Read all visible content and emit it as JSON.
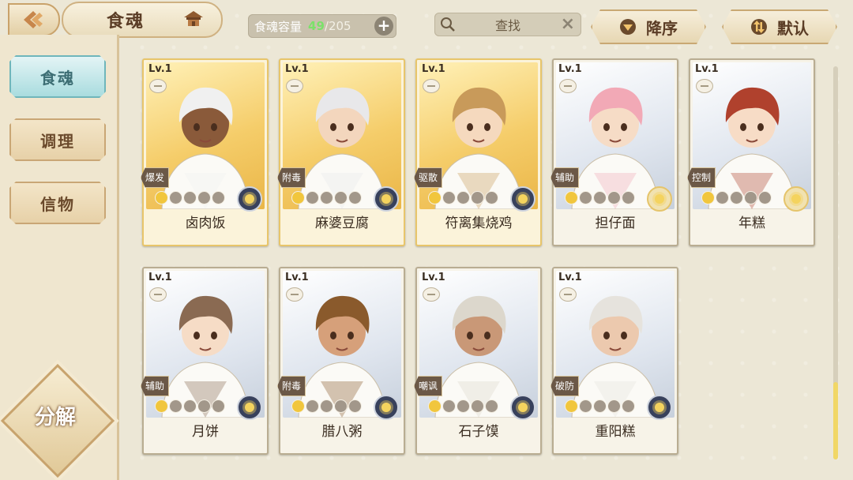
{
  "header": {
    "title": "食魂",
    "capacity_label": "食魂容量",
    "capacity_used": "49",
    "capacity_total": "/205",
    "search_label": "查找",
    "sort_desc_label": "降序",
    "sort_default_label": "默认"
  },
  "sidebar": {
    "tabs": [
      {
        "label": "食魂",
        "active": true
      },
      {
        "label": "调理",
        "active": false
      },
      {
        "label": "信物",
        "active": false
      }
    ],
    "decompose_label": "分解"
  },
  "cards": [
    {
      "level": "Lv.1",
      "name": "卤肉饭",
      "role": "爆发",
      "rarity": "gold",
      "stars": 1,
      "element": "night",
      "skin": "#8a5a3a",
      "hair": "#f0f0f0"
    },
    {
      "level": "Lv.1",
      "name": "麻婆豆腐",
      "role": "附毒",
      "rarity": "gold",
      "stars": 1,
      "element": "night",
      "skin": "#f3d6bd",
      "hair": "#e8e8ea"
    },
    {
      "level": "Lv.1",
      "name": "符离集烧鸡",
      "role": "驱散",
      "rarity": "gold",
      "stars": 1,
      "element": "night",
      "skin": "#f5d9be",
      "hair": "#c89a5a"
    },
    {
      "level": "Lv.1",
      "name": "担仔面",
      "role": "辅助",
      "rarity": "silver",
      "stars": 1,
      "element": "day",
      "skin": "#f6dcc6",
      "hair": "#f2a9b6"
    },
    {
      "level": "Lv.1",
      "name": "年糕",
      "role": "控制",
      "rarity": "silver",
      "stars": 1,
      "element": "day",
      "skin": "#f7dcc6",
      "hair": "#b0412d"
    },
    {
      "level": "Lv.1",
      "name": "月饼",
      "role": "辅助",
      "rarity": "silver",
      "stars": 1,
      "element": "night",
      "skin": "#f6dcc6",
      "hair": "#8a6a52"
    },
    {
      "level": "Lv.1",
      "name": "腊八粥",
      "role": "附毒",
      "rarity": "silver",
      "stars": 1,
      "element": "night",
      "skin": "#d6a07a",
      "hair": "#8a5a2c"
    },
    {
      "level": "Lv.1",
      "name": "石子馍",
      "role": "嘲讽",
      "rarity": "silver",
      "stars": 1,
      "element": "night",
      "skin": "#c99877",
      "hair": "#dcd7cc"
    },
    {
      "level": "Lv.1",
      "name": "重阳糕",
      "role": "破防",
      "rarity": "silver",
      "stars": 1,
      "element": "night",
      "skin": "#ecc9ae",
      "hair": "#e6e3dd"
    }
  ]
}
